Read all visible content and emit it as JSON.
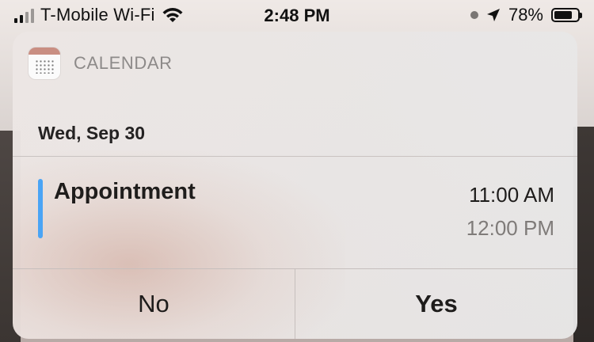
{
  "status_bar": {
    "carrier": "T-Mobile Wi-Fi",
    "time": "2:48 PM",
    "battery_percent": "78%",
    "battery_level": 0.78,
    "icons": [
      "signal-icon",
      "wifi-icon",
      "recording-dot-icon",
      "location-arrow-icon",
      "battery-icon"
    ]
  },
  "notification": {
    "app_name": "CALENDAR",
    "app_icon": "calendar-app-icon",
    "date": "Wed, Sep 30",
    "event": {
      "title": "Appointment",
      "start_time": "11:00 AM",
      "end_time": "12:00 PM",
      "color": "#4aa4f5"
    },
    "actions": {
      "no_label": "No",
      "yes_label": "Yes"
    }
  }
}
